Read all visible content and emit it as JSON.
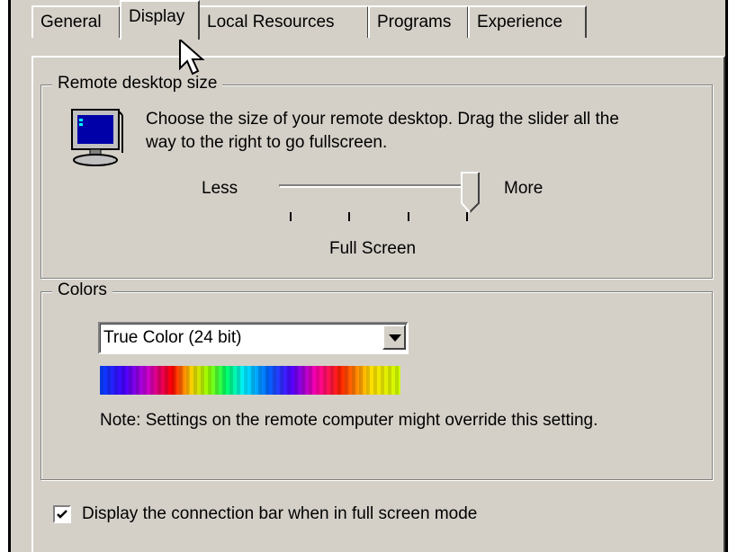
{
  "tabs": [
    {
      "label": "General"
    },
    {
      "label": "Display"
    },
    {
      "label": "Local Resources"
    },
    {
      "label": "Programs"
    },
    {
      "label": "Experience"
    }
  ],
  "remote_desktop_size": {
    "title": "Remote desktop size",
    "description_line1": "Choose the size of your remote desktop. Drag the slider all the",
    "description_line2": "way to the right to go fullscreen.",
    "less_label": "Less",
    "more_label": "More",
    "value_label": "Full Screen",
    "slider_level": 1.0,
    "icon": "monitor-icon"
  },
  "colors": {
    "title": "Colors",
    "selected": "True Color (24 bit)",
    "note": "Note: Settings on the remote computer might override this setting."
  },
  "connection_bar": {
    "label": "Display the connection bar when in full screen mode",
    "checked": true
  },
  "palette": {
    "face": "#d4d0c8",
    "shadow": "#808080",
    "highlight": "#ffffff"
  }
}
